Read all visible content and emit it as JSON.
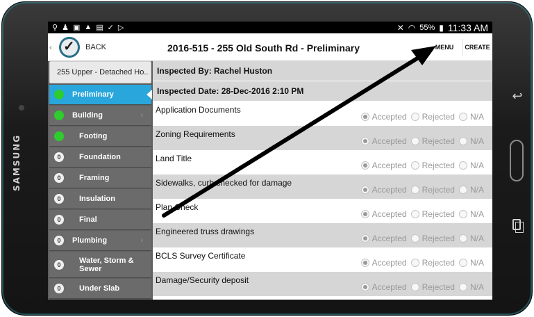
{
  "device": {
    "brand": "SAMSUNG"
  },
  "status_bar": {
    "battery": "55%",
    "time": "11:33 AM"
  },
  "header": {
    "back_label": "BACK",
    "title": "2016-515 - 255 Old South Rd - Preliminary",
    "menu_label": "MENU",
    "create_label": "CREATE"
  },
  "sidebar": {
    "title": "255 Upper - Detached Ho..",
    "items": [
      {
        "label": "Preliminary",
        "status": "green",
        "active": true,
        "chevron": false
      },
      {
        "label": "Building",
        "status": "green",
        "active": false,
        "chevron": true
      },
      {
        "label": "Footing",
        "status": "green",
        "active": false,
        "chevron": false
      },
      {
        "label": "Foundation",
        "status": "0",
        "active": false,
        "chevron": false
      },
      {
        "label": "Framing",
        "status": "0",
        "active": false,
        "chevron": false
      },
      {
        "label": "Insulation",
        "status": "0",
        "active": false,
        "chevron": false
      },
      {
        "label": "Final",
        "status": "0",
        "active": false,
        "chevron": false
      },
      {
        "label": "Plumbing",
        "status": "0",
        "active": false,
        "chevron": true
      },
      {
        "label": "Water, Storm & Sewer",
        "status": "0",
        "active": false,
        "chevron": false
      },
      {
        "label": "Under Slab",
        "status": "0",
        "active": false,
        "chevron": false
      }
    ]
  },
  "inspection": {
    "inspected_by": "Inspected By: Rachel Huston",
    "inspected_date": "Inspected Date: 28-Dec-2016 2:10 PM"
  },
  "options": {
    "accepted": "Accepted",
    "rejected": "Rejected",
    "na": "N/A"
  },
  "checklist": [
    {
      "label": "Application Documents",
      "selected": "accepted"
    },
    {
      "label": "Zoning Requirements",
      "selected": "accepted"
    },
    {
      "label": "Land Title",
      "selected": "accepted"
    },
    {
      "label": "Sidewalks, curb checked for damage",
      "selected": "accepted"
    },
    {
      "label": "Plan Check",
      "selected": "accepted"
    },
    {
      "label": "Engineered truss drawings",
      "selected": "accepted"
    },
    {
      "label": "BCLS Survey Certificate",
      "selected": "accepted"
    },
    {
      "label": "Damage/Security deposit",
      "selected": "accepted"
    }
  ],
  "colors": {
    "active_tab": "#29a6dc",
    "status_green": "#2ecc2e",
    "sidebar_bg": "#6b6b6b",
    "row_alt": "#d6d6d6"
  }
}
